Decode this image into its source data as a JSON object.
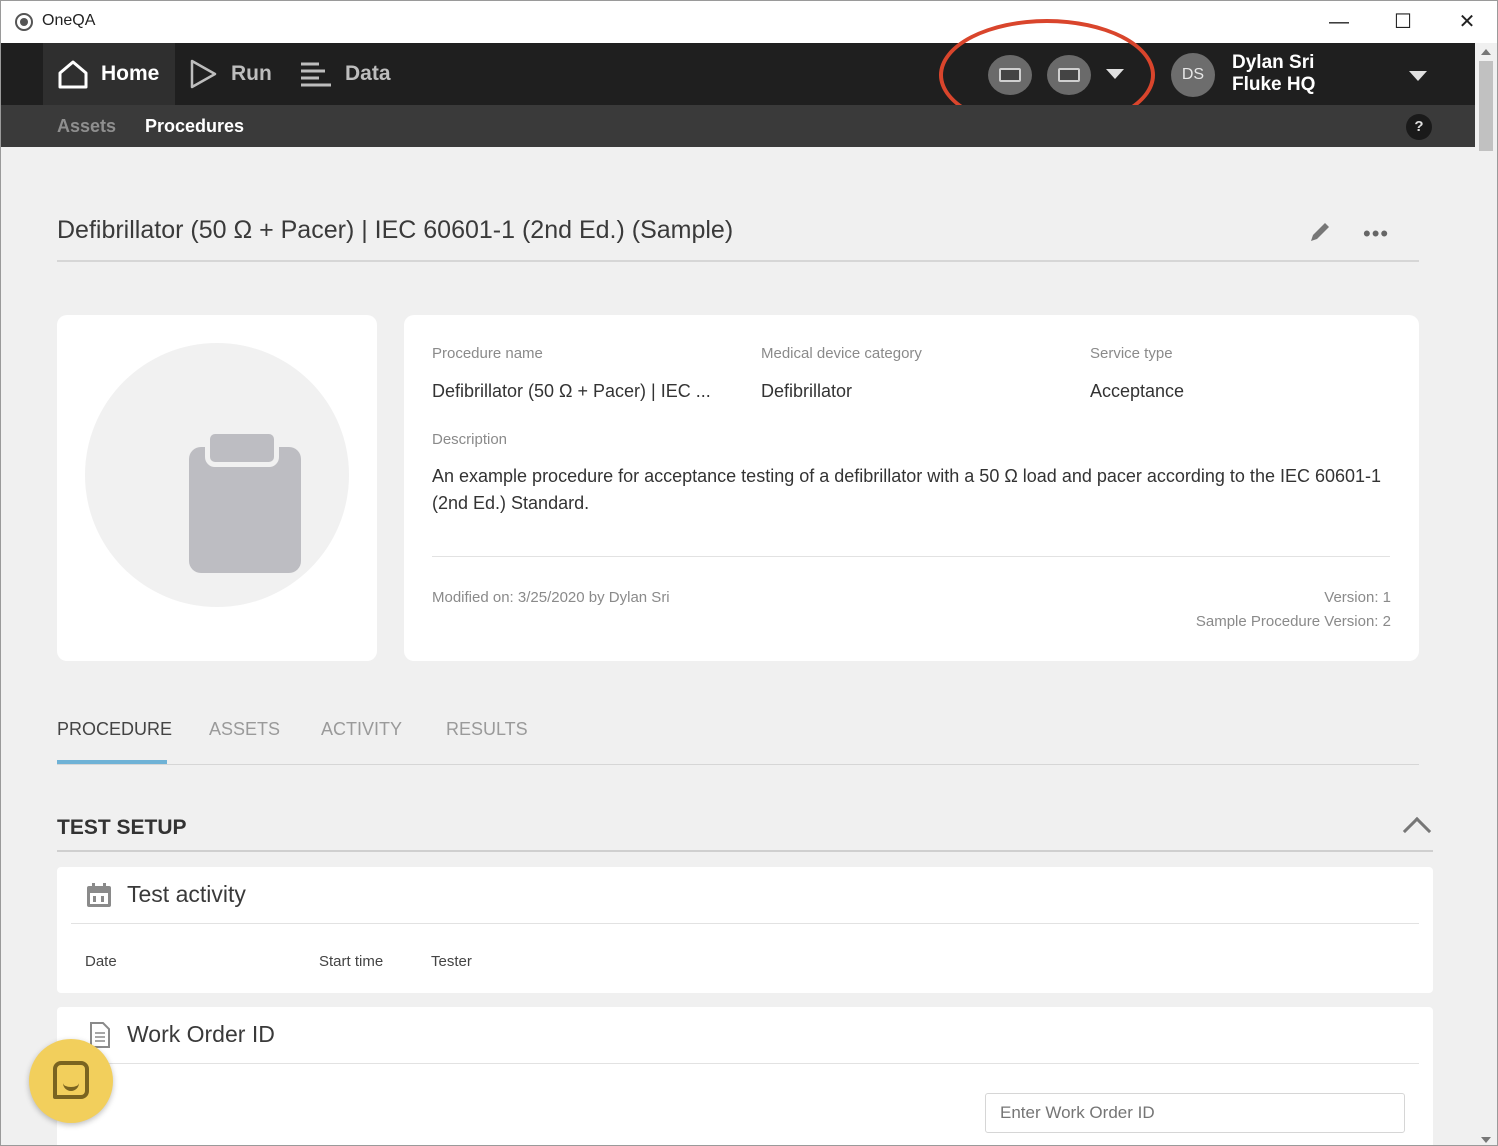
{
  "window": {
    "app_title": "OneQA",
    "minimize": "—",
    "maximize": "☐",
    "close": "✕"
  },
  "topnav": {
    "items": [
      {
        "label": "Home",
        "icon": "home-icon",
        "active": true
      },
      {
        "label": "Run",
        "icon": "play-icon",
        "active": false
      },
      {
        "label": "Data",
        "icon": "list-icon",
        "active": false
      }
    ],
    "device_buttons": [
      "device-icon",
      "printer-icon"
    ],
    "user": {
      "initials": "DS",
      "name": "Dylan Sri",
      "org": "Fluke HQ"
    }
  },
  "subnav": {
    "items": [
      {
        "label": "Assets",
        "active": false
      },
      {
        "label": "Procedures",
        "active": true
      }
    ],
    "help": "?"
  },
  "page": {
    "title": "Defibrillator (50 Ω + Pacer) | IEC 60601-1 (2nd Ed.) (Sample)",
    "more": "•••"
  },
  "details": {
    "procedure_name_label": "Procedure name",
    "procedure_name": "Defibrillator (50 Ω + Pacer) | IEC ...",
    "category_label": "Medical device category",
    "category": "Defibrillator",
    "service_type_label": "Service type",
    "service_type": "Acceptance",
    "description_label": "Description",
    "description": "An example procedure for acceptance testing of a defibrillator with a 50 Ω load and pacer according to the IEC 60601-1 (2nd Ed.) Standard.",
    "modified": "Modified on: 3/25/2020 by Dylan Sri",
    "version": "Version: 1",
    "sample_version": "Sample Procedure Version: 2"
  },
  "tabs": [
    {
      "label": "PROCEDURE",
      "active": true
    },
    {
      "label": "ASSETS",
      "active": false
    },
    {
      "label": "ACTIVITY",
      "active": false
    },
    {
      "label": "RESULTS",
      "active": false
    }
  ],
  "test_setup": {
    "title": "TEST SETUP",
    "activity": {
      "title": "Test activity",
      "columns": [
        "Date",
        "Start time",
        "Tester"
      ]
    },
    "work_order": {
      "title": "Work Order ID",
      "placeholder": "Enter Work Order ID"
    }
  },
  "colors": {
    "nav_bg": "#1f1f1f",
    "subnav_bg": "#3a3a3a",
    "tab_accent": "#6fb2d6",
    "highlight": "#d9452c",
    "chat": "#f2cf5c"
  }
}
